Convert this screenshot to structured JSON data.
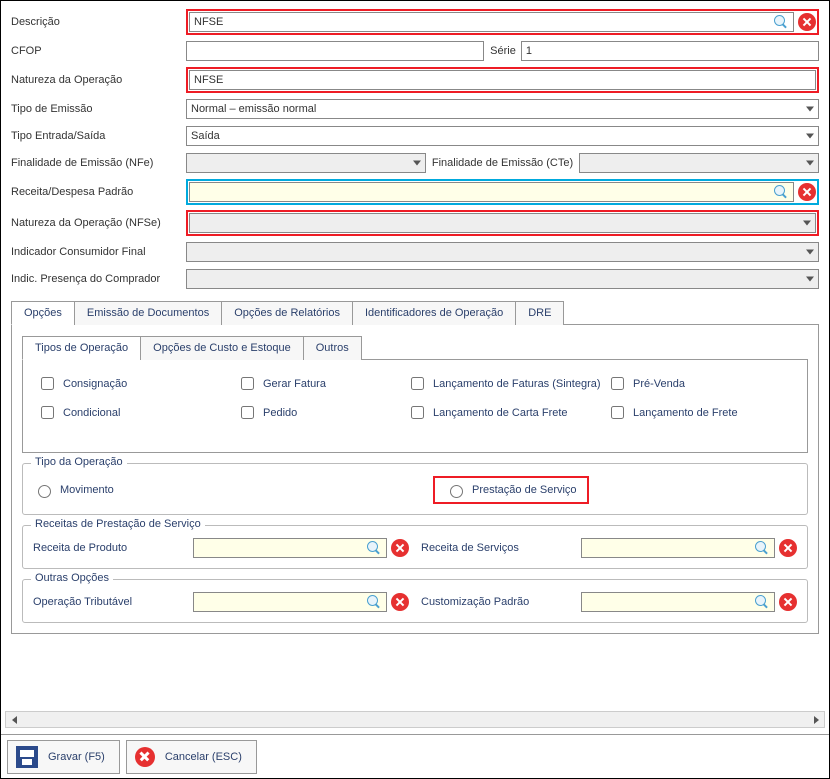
{
  "labels": {
    "descricao": "Descrição",
    "cfop": "CFOP",
    "serie": "Série",
    "natureza_operacao": "Natureza da Operação",
    "tipo_emissao": "Tipo de Emissão",
    "tipo_entrada_saida": "Tipo Entrada/Saída",
    "finalidade_nfe": "Finalidade de Emissão (NFe)",
    "finalidade_cte": "Finalidade de Emissão (CTe)",
    "receita_despesa_padrao": "Receita/Despesa Padrão",
    "natureza_operacao_nfse": "Natureza da Operação (NFSe)",
    "indicador_consumidor_final": "Indicador Consumidor Final",
    "indic_presenca_comprador": "Indic. Presença do Comprador"
  },
  "fields": {
    "descricao": "NFSE",
    "cfop": "",
    "serie": "1",
    "natureza_operacao": "NFSE",
    "tipo_emissao": "Normal – emissão normal",
    "tipo_entrada_saida": "Saída",
    "finalidade_nfe": "",
    "finalidade_cte": "",
    "receita_despesa_padrao": "",
    "natureza_operacao_nfse": "",
    "indicador_consumidor_final": "",
    "indic_presenca_comprador": ""
  },
  "tabs": {
    "main": [
      "Opções",
      "Emissão de Documentos",
      "Opções de Relatórios",
      "Identificadores de Operação",
      "DRE"
    ],
    "inner": [
      "Tipos de Operação",
      "Opções de Custo e Estoque",
      "Outros"
    ]
  },
  "checkboxes": {
    "consignacao": "Consignação",
    "gerar_fatura": "Gerar Fatura",
    "lanc_faturas_sintegra": "Lançamento de Faturas (Sintegra)",
    "pre_venda": "Pré-Venda",
    "condicional": "Condicional",
    "pedido": "Pedido",
    "lanc_carta_frete": "Lançamento de Carta Frete",
    "lanc_frete": "Lançamento de Frete"
  },
  "tipo_operacao": {
    "title": "Tipo da Operação",
    "movimento": "Movimento",
    "prestacao_servico": "Prestação de Serviço"
  },
  "receitas_prestacao": {
    "title": "Receitas de Prestação de Serviço",
    "receita_produto_label": "Receita de Produto",
    "receita_produto_value": "",
    "receita_servicos_label": "Receita de Serviços",
    "receita_servicos_value": ""
  },
  "outras_opcoes": {
    "title": "Outras Opções",
    "operacao_tributavel_label": "Operação Tributável",
    "operacao_tributavel_value": "",
    "customizacao_padrao_label": "Customização Padrão",
    "customizacao_padrao_value": ""
  },
  "footer": {
    "gravar": "Gravar (F5)",
    "cancelar": "Cancelar (ESC)"
  }
}
